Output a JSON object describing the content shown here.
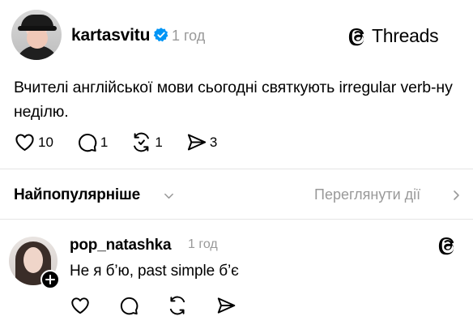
{
  "post": {
    "author": "kartasvitu",
    "verified": true,
    "time": "1 год",
    "text": "Вчителі англійської мови сьогодні святкують irregular verb-ну неділю.",
    "likes": "10",
    "replies": "1",
    "reposts": "1",
    "shares": "3"
  },
  "brand": {
    "label": "Threads"
  },
  "sort": {
    "label": "Найпопулярніше",
    "view_activity": "Переглянути дії"
  },
  "reply": {
    "author": "pop_natashka",
    "time": "1 год",
    "text": "Не я б’ю, past simple б’є"
  },
  "icons": {
    "verified": "verified-badge-icon",
    "threads": "threads-logo-icon",
    "like": "heart-icon",
    "reply": "speech-bubble-icon",
    "repost": "repost-icon",
    "share": "send-icon",
    "chevron_down": "chevron-down-icon",
    "chevron_right": "chevron-right-icon",
    "follow": "plus-icon"
  },
  "colors": {
    "verified_blue": "#0095f6",
    "muted": "#999999",
    "divider": "#e5e5e5"
  }
}
